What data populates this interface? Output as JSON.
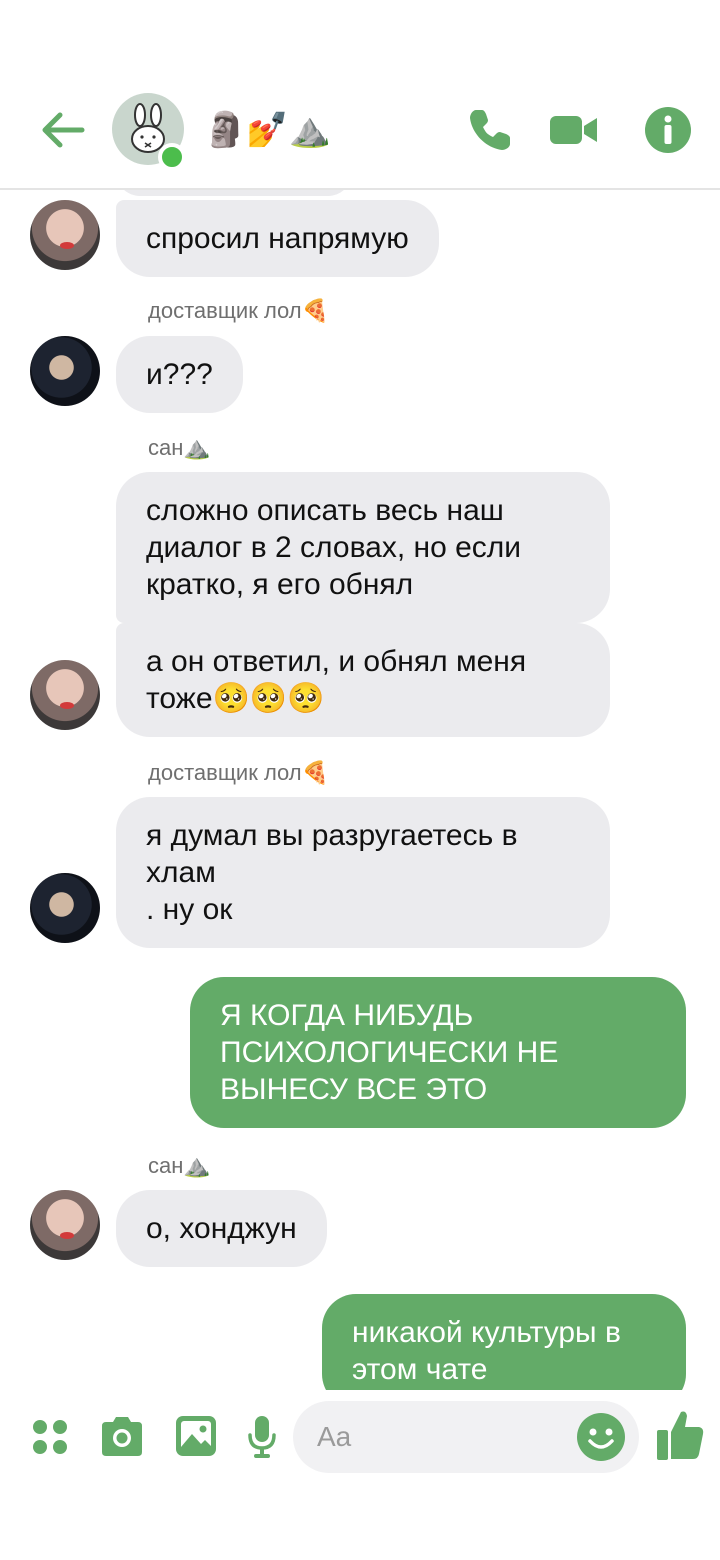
{
  "header": {
    "title": "🗿💅⛰️",
    "colors": {
      "accent": "#63ab68",
      "online": "#4cbd4c"
    }
  },
  "messages": [
    {
      "type": "incoming",
      "text": "спросил напрямую"
    },
    {
      "sender": "доставщик лол🍕",
      "type": "incoming",
      "text": "и???"
    },
    {
      "sender": "сан⛰️",
      "type": "incoming",
      "text": "сложно описать весь наш\nдиалог в 2 словах, но если\nкратко, я его обнял"
    },
    {
      "type": "incoming",
      "text": "а он ответил, и обнял меня\nтоже🥺🥺🥺"
    },
    {
      "sender": "доставщик лол🍕",
      "type": "incoming",
      "text": "я думал вы разругаетесь в\nхлам\n. ну ок"
    },
    {
      "type": "outgoing",
      "text": "Я КОГДА НИБУДЬ\nПСИХОЛОГИЧЕСКИ НЕ\nВЫНЕСУ ВСЕ ЭТО"
    },
    {
      "sender": "сан⛰️",
      "type": "incoming",
      "text": "о, хонджун"
    },
    {
      "type": "outgoing",
      "text": "никакой культуры в\nэтом чате"
    }
  ],
  "composer": {
    "placeholder": "Aa"
  },
  "icons": [
    "back-arrow-icon",
    "phone-icon",
    "video-camera-icon",
    "info-icon",
    "apps-grid-icon",
    "camera-icon",
    "image-icon",
    "microphone-icon",
    "emoji-icon",
    "thumbs-up-icon"
  ]
}
